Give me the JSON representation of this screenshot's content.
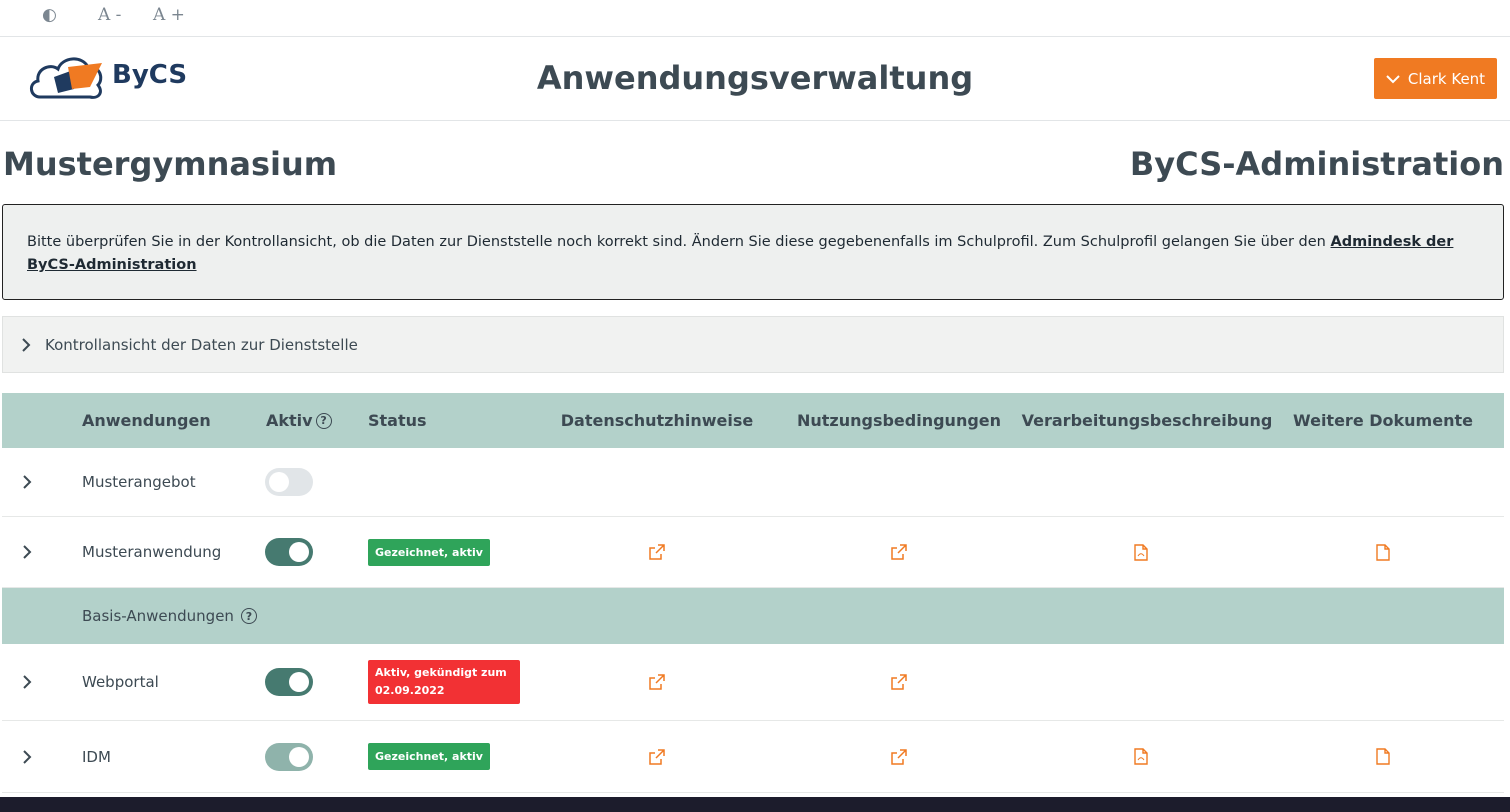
{
  "a11y": {
    "contrast_icon": "contrast-icon",
    "decrease_label": "A -",
    "increase_label": "A +"
  },
  "header": {
    "logo_text": "ByCS",
    "title": "Anwendungsverwaltung",
    "user_name": "Clark Kent"
  },
  "school": {
    "name": "Mustergymnasium",
    "admin_title": "ByCS-Administration"
  },
  "notice": {
    "text": "Bitte überprüfen Sie in der Kontrollansicht, ob die Daten zur Dienststelle noch korrekt sind. Ändern Sie diese gegebenenfalls im Schulprofil. Zum Schulprofil gelangen Sie über den ",
    "link_text": "Admindesk der ByCS-Administration"
  },
  "accordion": {
    "label": "Kontrollansicht der Daten zur Dienststelle"
  },
  "table": {
    "headers": {
      "apps": "Anwendungen",
      "active": "Aktiv",
      "status": "Status",
      "privacy": "Datenschutzhinweise",
      "terms": "Nutzungsbedingungen",
      "processing": "Verarbeitungsbeschreibung",
      "docs": "Weitere Dokumente"
    },
    "rows": [
      {
        "name": "Musterangebot",
        "active": false,
        "status": ""
      },
      {
        "name": "Musteranwendung",
        "active": true,
        "status": "Gezeichnet, aktiv"
      }
    ],
    "group_label": "Basis-Anwendungen",
    "base_rows": [
      {
        "name": "Webportal",
        "active": true,
        "status_line1": "Aktiv, gekündigt zum",
        "status_line2": "02.09.2022"
      },
      {
        "name": "IDM",
        "active": true,
        "status": "Gezeichnet, aktiv"
      }
    ]
  },
  "colors": {
    "accent": "#f07a22",
    "teal_header": "#b3d1ca",
    "toggle_on": "#467a70",
    "badge_green": "#2fa45a",
    "badge_red": "#f23134"
  }
}
